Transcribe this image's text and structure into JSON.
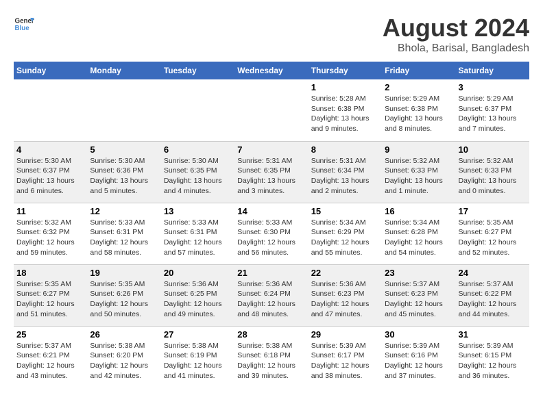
{
  "header": {
    "logo_line1": "General",
    "logo_line2": "Blue",
    "title": "August 2024",
    "subtitle": "Bhola, Barisal, Bangladesh"
  },
  "weekdays": [
    "Sunday",
    "Monday",
    "Tuesday",
    "Wednesday",
    "Thursday",
    "Friday",
    "Saturday"
  ],
  "weeks": [
    [
      {
        "day": "",
        "info": ""
      },
      {
        "day": "",
        "info": ""
      },
      {
        "day": "",
        "info": ""
      },
      {
        "day": "",
        "info": ""
      },
      {
        "day": "1",
        "info": "Sunrise: 5:28 AM\nSunset: 6:38 PM\nDaylight: 13 hours\nand 9 minutes."
      },
      {
        "day": "2",
        "info": "Sunrise: 5:29 AM\nSunset: 6:38 PM\nDaylight: 13 hours\nand 8 minutes."
      },
      {
        "day": "3",
        "info": "Sunrise: 5:29 AM\nSunset: 6:37 PM\nDaylight: 13 hours\nand 7 minutes."
      }
    ],
    [
      {
        "day": "4",
        "info": "Sunrise: 5:30 AM\nSunset: 6:37 PM\nDaylight: 13 hours\nand 6 minutes."
      },
      {
        "day": "5",
        "info": "Sunrise: 5:30 AM\nSunset: 6:36 PM\nDaylight: 13 hours\nand 5 minutes."
      },
      {
        "day": "6",
        "info": "Sunrise: 5:30 AM\nSunset: 6:35 PM\nDaylight: 13 hours\nand 4 minutes."
      },
      {
        "day": "7",
        "info": "Sunrise: 5:31 AM\nSunset: 6:35 PM\nDaylight: 13 hours\nand 3 minutes."
      },
      {
        "day": "8",
        "info": "Sunrise: 5:31 AM\nSunset: 6:34 PM\nDaylight: 13 hours\nand 2 minutes."
      },
      {
        "day": "9",
        "info": "Sunrise: 5:32 AM\nSunset: 6:33 PM\nDaylight: 13 hours\nand 1 minute."
      },
      {
        "day": "10",
        "info": "Sunrise: 5:32 AM\nSunset: 6:33 PM\nDaylight: 13 hours\nand 0 minutes."
      }
    ],
    [
      {
        "day": "11",
        "info": "Sunrise: 5:32 AM\nSunset: 6:32 PM\nDaylight: 12 hours\nand 59 minutes."
      },
      {
        "day": "12",
        "info": "Sunrise: 5:33 AM\nSunset: 6:31 PM\nDaylight: 12 hours\nand 58 minutes."
      },
      {
        "day": "13",
        "info": "Sunrise: 5:33 AM\nSunset: 6:31 PM\nDaylight: 12 hours\nand 57 minutes."
      },
      {
        "day": "14",
        "info": "Sunrise: 5:33 AM\nSunset: 6:30 PM\nDaylight: 12 hours\nand 56 minutes."
      },
      {
        "day": "15",
        "info": "Sunrise: 5:34 AM\nSunset: 6:29 PM\nDaylight: 12 hours\nand 55 minutes."
      },
      {
        "day": "16",
        "info": "Sunrise: 5:34 AM\nSunset: 6:28 PM\nDaylight: 12 hours\nand 54 minutes."
      },
      {
        "day": "17",
        "info": "Sunrise: 5:35 AM\nSunset: 6:27 PM\nDaylight: 12 hours\nand 52 minutes."
      }
    ],
    [
      {
        "day": "18",
        "info": "Sunrise: 5:35 AM\nSunset: 6:27 PM\nDaylight: 12 hours\nand 51 minutes."
      },
      {
        "day": "19",
        "info": "Sunrise: 5:35 AM\nSunset: 6:26 PM\nDaylight: 12 hours\nand 50 minutes."
      },
      {
        "day": "20",
        "info": "Sunrise: 5:36 AM\nSunset: 6:25 PM\nDaylight: 12 hours\nand 49 minutes."
      },
      {
        "day": "21",
        "info": "Sunrise: 5:36 AM\nSunset: 6:24 PM\nDaylight: 12 hours\nand 48 minutes."
      },
      {
        "day": "22",
        "info": "Sunrise: 5:36 AM\nSunset: 6:23 PM\nDaylight: 12 hours\nand 47 minutes."
      },
      {
        "day": "23",
        "info": "Sunrise: 5:37 AM\nSunset: 6:23 PM\nDaylight: 12 hours\nand 45 minutes."
      },
      {
        "day": "24",
        "info": "Sunrise: 5:37 AM\nSunset: 6:22 PM\nDaylight: 12 hours\nand 44 minutes."
      }
    ],
    [
      {
        "day": "25",
        "info": "Sunrise: 5:37 AM\nSunset: 6:21 PM\nDaylight: 12 hours\nand 43 minutes."
      },
      {
        "day": "26",
        "info": "Sunrise: 5:38 AM\nSunset: 6:20 PM\nDaylight: 12 hours\nand 42 minutes."
      },
      {
        "day": "27",
        "info": "Sunrise: 5:38 AM\nSunset: 6:19 PM\nDaylight: 12 hours\nand 41 minutes."
      },
      {
        "day": "28",
        "info": "Sunrise: 5:38 AM\nSunset: 6:18 PM\nDaylight: 12 hours\nand 39 minutes."
      },
      {
        "day": "29",
        "info": "Sunrise: 5:39 AM\nSunset: 6:17 PM\nDaylight: 12 hours\nand 38 minutes."
      },
      {
        "day": "30",
        "info": "Sunrise: 5:39 AM\nSunset: 6:16 PM\nDaylight: 12 hours\nand 37 minutes."
      },
      {
        "day": "31",
        "info": "Sunrise: 5:39 AM\nSunset: 6:15 PM\nDaylight: 12 hours\nand 36 minutes."
      }
    ]
  ]
}
